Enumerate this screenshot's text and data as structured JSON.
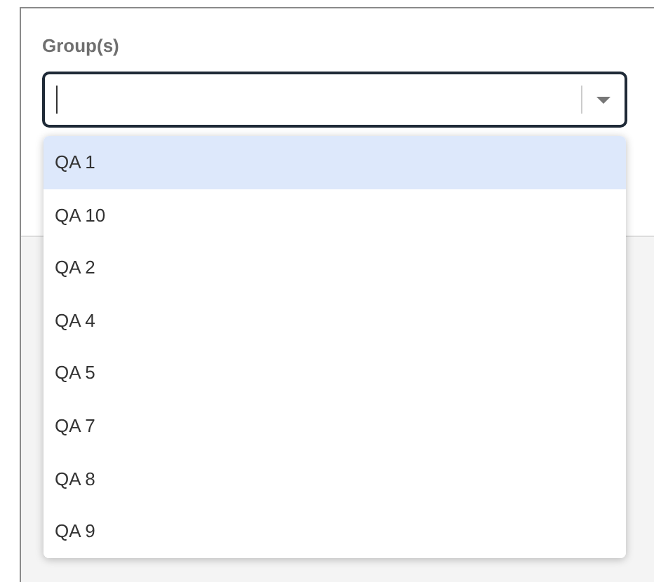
{
  "field": {
    "label": "Group(s)"
  },
  "options": [
    {
      "label": "QA 1",
      "selected": true
    },
    {
      "label": "QA 10",
      "selected": false
    },
    {
      "label": "QA 2",
      "selected": false
    },
    {
      "label": "QA 4",
      "selected": false
    },
    {
      "label": "QA 5",
      "selected": false
    },
    {
      "label": "QA 7",
      "selected": false
    },
    {
      "label": "QA 8",
      "selected": false
    },
    {
      "label": "QA 9",
      "selected": false
    }
  ]
}
